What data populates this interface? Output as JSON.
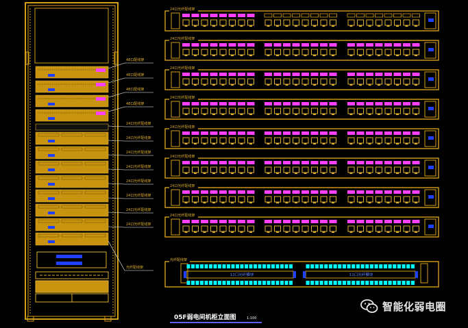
{
  "drawing": {
    "title": "05F弱电间机柜立面图",
    "scale": "1:100"
  },
  "colors": {
    "background": "#000000",
    "cabinet": "#d4a017",
    "panel_fill": "#c89410",
    "frame": "#e0b030",
    "port_magenta": "#ff40ff",
    "port_blue": "#2040ff",
    "port_cyan": "#00ffff",
    "leader": "#ffffff"
  },
  "cabinet_labels": [
    "48口配线架",
    "48口配线架",
    "48口配线架",
    "48口配线架",
    "24口光纤配线架",
    "24口光纤配线架",
    "24口光纤配线架",
    "24口光纤配线架",
    "24口光纤配线架",
    "24口光纤配线架",
    "24口光纤配线架",
    "24口光纤配线架",
    "光纤配线架"
  ],
  "panels": [
    {
      "label": "24口光纤配线架"
    },
    {
      "label": "24口光纤配线架"
    },
    {
      "label": "24口光纤配线架"
    },
    {
      "label": "24口光纤配线架"
    },
    {
      "label": "24口光纤配线架"
    },
    {
      "label": "24口光纤配线架"
    },
    {
      "label": "24口光纤配线架"
    },
    {
      "label": "24口光纤配线架"
    }
  ],
  "fiber_panel": {
    "label": "光纤配线架",
    "module_left": "12口光纤模块",
    "module_right": "12口光纤模块"
  },
  "watermark": {
    "icon": "wechat-icon",
    "text": "智能化弱电圈"
  }
}
